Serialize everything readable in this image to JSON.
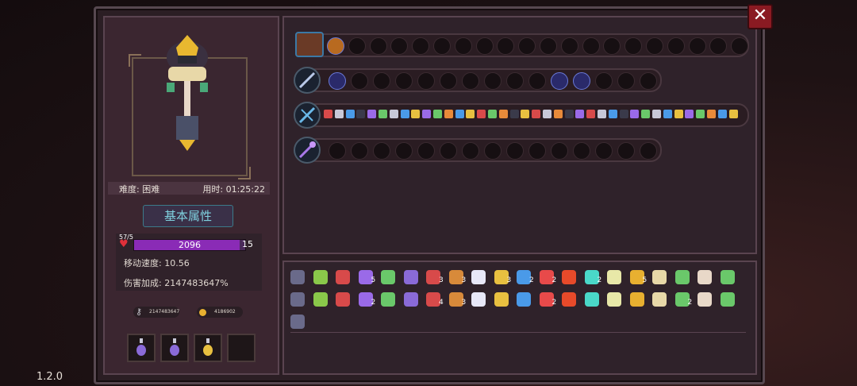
{
  "left_panel": {
    "difficulty_label": "难度: 困难",
    "time_label": "用时: 01:25:22",
    "attributes_button": "基本属性",
    "hp_left": "57/5",
    "hp_value": "2096",
    "hp_right": "15",
    "hp_fill": 0.95,
    "move_speed": "移动速度: 10.56",
    "damage_bonus": "伤害加成: 2147483647%",
    "keys": "2147483647",
    "coins": "4186902"
  },
  "potions": [
    {
      "name": "purple-potion-icon",
      "color": "#8a6ad8"
    },
    {
      "name": "purple-potion-icon",
      "color": "#8a6ad8"
    },
    {
      "name": "yellow-potion-icon",
      "color": "#e8c040"
    },
    {
      "name": "empty-slot",
      "color": ""
    }
  ],
  "weapon_rows": [
    {
      "name": "chest-row",
      "icon": "treasure-chest-icon"
    },
    {
      "name": "spear-row",
      "icon": "spear-icon"
    },
    {
      "name": "crossbow-row",
      "icon": "crossbow-icon"
    },
    {
      "name": "staff-row",
      "icon": "magic-staff-icon"
    }
  ],
  "item_counts": [
    "5",
    "3",
    "3",
    "3",
    "2",
    "2",
    "2",
    "5",
    "2",
    "4",
    "3",
    "2",
    "2"
  ],
  "version": "1.2.0",
  "colors": {
    "hp": "#8a2bb6",
    "accent": "#7fd0de",
    "close": "#8a1a22"
  }
}
